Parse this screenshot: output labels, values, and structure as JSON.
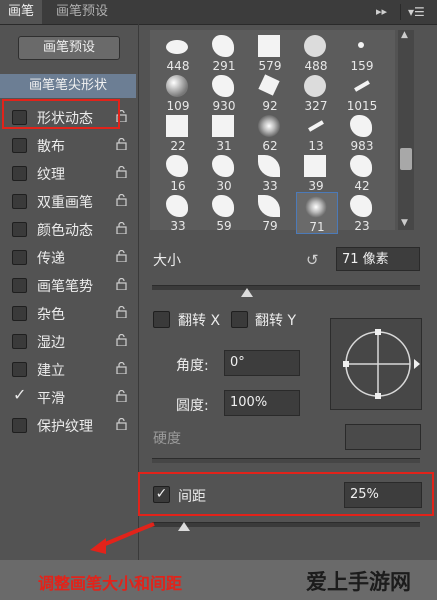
{
  "tabs": [
    {
      "label": "画笔",
      "active": true
    },
    {
      "label": "画笔预设",
      "active": false
    }
  ],
  "topbar": {
    "forward_icon": "double-chevron-right-icon",
    "menu_icon": "panel-menu-icon"
  },
  "left_panel": {
    "preset_button": "画笔预设",
    "header": "画笔笔尖形状",
    "options": [
      {
        "label": "形状动态",
        "checked": false
      },
      {
        "label": "散布",
        "checked": false
      },
      {
        "label": "纹理",
        "checked": false
      },
      {
        "label": "双重画笔",
        "checked": false
      },
      {
        "label": "颜色动态",
        "checked": false
      },
      {
        "label": "传递",
        "checked": false
      },
      {
        "label": "画笔笔势",
        "checked": false
      },
      {
        "label": "杂色",
        "checked": false
      },
      {
        "label": "湿边",
        "checked": false
      },
      {
        "label": "建立",
        "checked": false
      },
      {
        "label": "平滑",
        "checked": true
      },
      {
        "label": "保护纹理",
        "checked": false
      }
    ]
  },
  "brushes": [
    [
      "448",
      "291",
      "579",
      "488",
      "159"
    ],
    [
      "109",
      "930",
      "92",
      "327",
      "1015"
    ],
    [
      "22",
      "31",
      "62",
      "13",
      "983"
    ],
    [
      "16",
      "30",
      "33",
      "39",
      "42"
    ],
    [
      "33",
      "59",
      "79",
      "71",
      "23"
    ]
  ],
  "selected_brush": "71",
  "size": {
    "label": "大小",
    "value": "71 像素",
    "reset_icon": "reset-icon"
  },
  "flip": {
    "x_label": "翻转 X",
    "y_label": "翻转 Y"
  },
  "angle": {
    "label": "角度:",
    "value": "0°"
  },
  "roundness": {
    "label": "圆度:",
    "value": "100%"
  },
  "hardness": {
    "label": "硬度",
    "value": ""
  },
  "spacing": {
    "label": "间距",
    "value": "25%",
    "checked": true
  },
  "annotation": {
    "text": "调整画笔大小和间距"
  },
  "watermark": {
    "text": "爱上手游网"
  },
  "colors": {
    "accent_red": "#e2231a",
    "header_blue": "#6c7e94",
    "panel": "#535353"
  }
}
